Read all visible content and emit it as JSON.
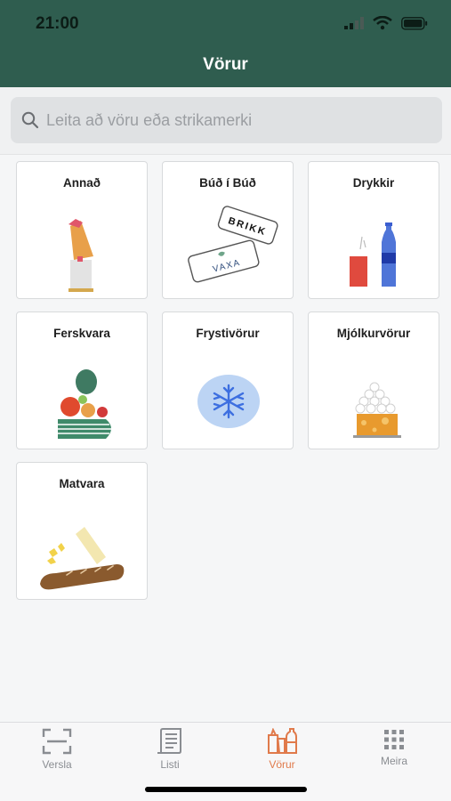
{
  "status_bar": {
    "time": "21:00"
  },
  "header": {
    "title": "Vörur"
  },
  "search": {
    "placeholder": "Leita að vöru eða strikamerki",
    "value": ""
  },
  "categories": [
    {
      "label": "Annað",
      "icon": "bag-on-jar-icon"
    },
    {
      "label": "Búð í Búð",
      "icon": "brikk-vaxa-tags-icon",
      "tag1": "BRIKK",
      "tag2": "VAXA"
    },
    {
      "label": "Drykkir",
      "icon": "can-and-bottle-icon"
    },
    {
      "label": "Ferskvara",
      "icon": "fresh-produce-icon"
    },
    {
      "label": "Frystivörur",
      "icon": "snowflake-icon"
    },
    {
      "label": "Mjólkurvörur",
      "icon": "cheese-and-eggs-icon"
    },
    {
      "label": "Matvara",
      "icon": "bread-and-butter-icon"
    }
  ],
  "tabbar": {
    "tabs": [
      {
        "label": "Versla",
        "icon": "scan-icon"
      },
      {
        "label": "Listi",
        "icon": "list-icon"
      },
      {
        "label": "Vörur",
        "icon": "groceries-icon",
        "active": true
      },
      {
        "label": "Meira",
        "icon": "grid-icon"
      }
    ]
  },
  "colors": {
    "header": "#2f5d4f",
    "accent": "#e07a4b"
  }
}
